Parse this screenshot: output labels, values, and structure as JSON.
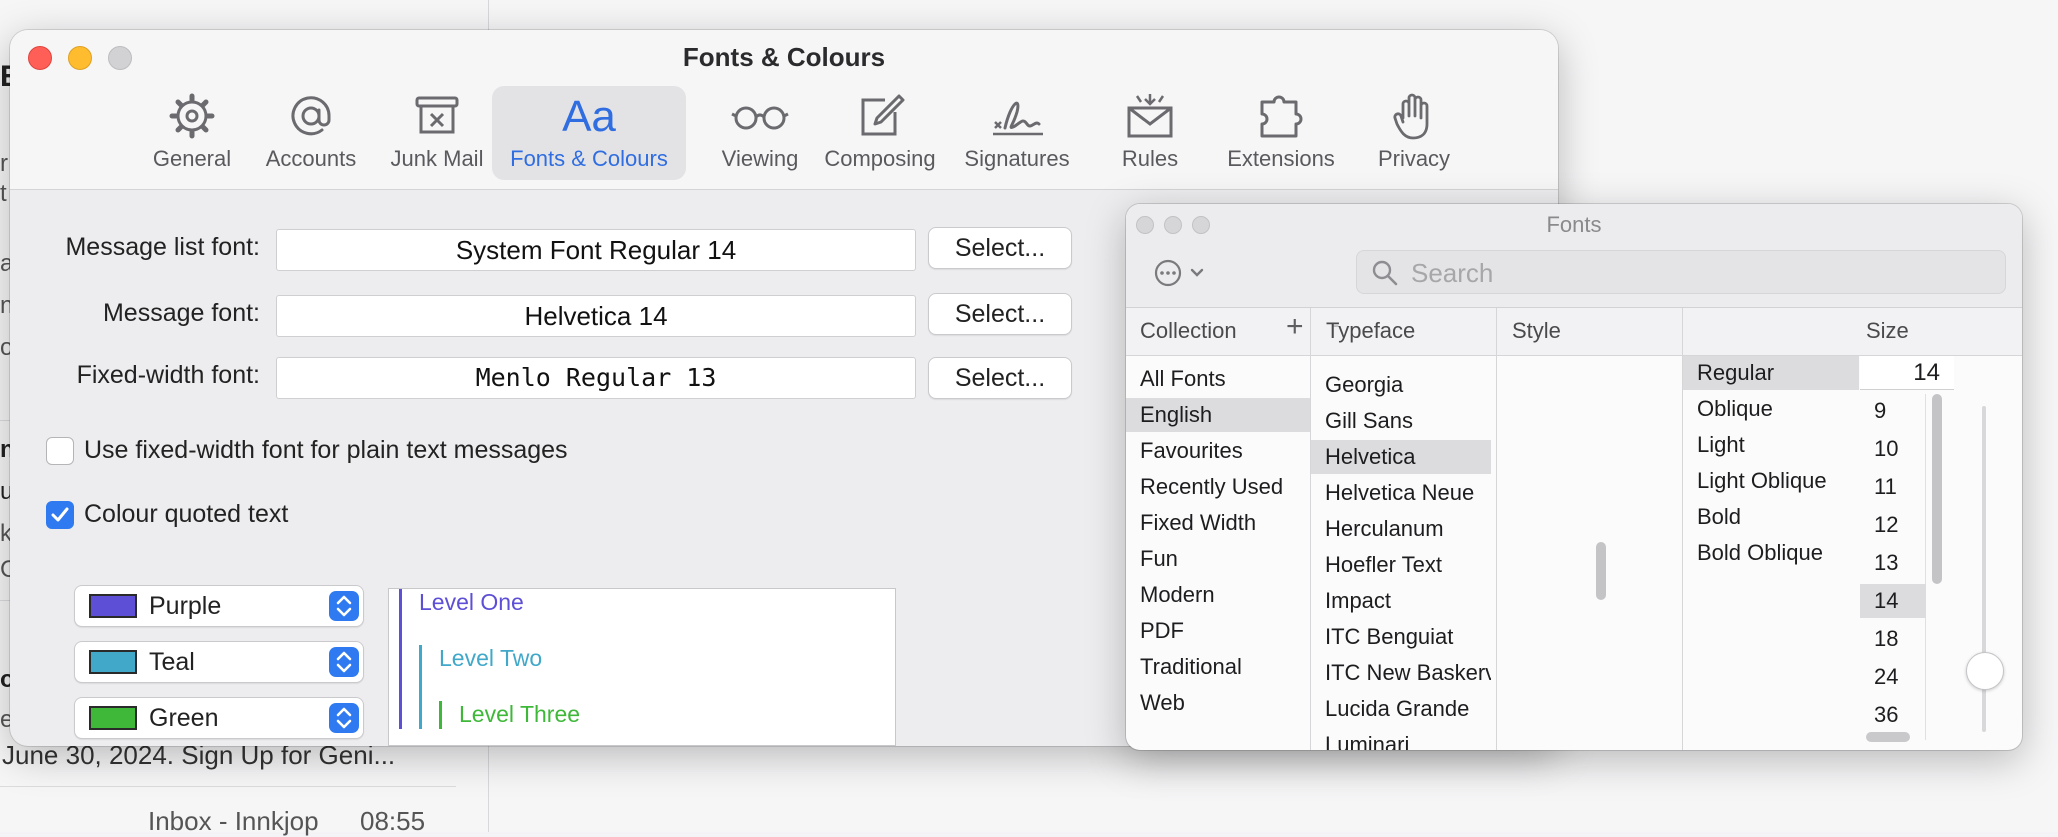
{
  "background": {
    "fragments": [
      "Er",
      "r",
      "t",
      "ab",
      "ne",
      "oc",
      "na",
      "ul",
      "ka",
      "C",
      "oc",
      "ex"
    ],
    "preview_text": "June 30, 2024. Sign Up for Geni...",
    "inbox_label": "Inbox - Innkjop",
    "inbox_time": "08:55"
  },
  "prefs": {
    "title": "Fonts & Colours",
    "tabs": [
      {
        "label": "General",
        "icon": "gear-icon"
      },
      {
        "label": "Accounts",
        "icon": "at-icon"
      },
      {
        "label": "Junk Mail",
        "icon": "junk-mail-icon"
      },
      {
        "label": "Fonts & Colours",
        "icon": "fonts-aa-icon",
        "glyph": "Aa",
        "active": true
      },
      {
        "label": "Viewing",
        "icon": "glasses-icon"
      },
      {
        "label": "Composing",
        "icon": "compose-icon"
      },
      {
        "label": "Signatures",
        "icon": "signature-icon"
      },
      {
        "label": "Rules",
        "icon": "rules-envelope-icon"
      },
      {
        "label": "Extensions",
        "icon": "puzzle-icon"
      },
      {
        "label": "Privacy",
        "icon": "hand-icon"
      }
    ],
    "fonts": [
      {
        "label": "Message list font:",
        "value": "System Font Regular 14",
        "button": "Select..."
      },
      {
        "label": "Message font:",
        "value": "Helvetica 14",
        "button": "Select..."
      },
      {
        "label": "Fixed-width font:",
        "value": "Menlo Regular 13",
        "button": "Select..."
      }
    ],
    "fixed_width_checkbox": {
      "label": "Use fixed-width font for plain text messages",
      "checked": false
    },
    "colour_quoted_checkbox": {
      "label": "Colour quoted text",
      "checked": true
    },
    "quote_colours": [
      {
        "name": "Purple",
        "color": "#5d4fd6"
      },
      {
        "name": "Teal",
        "color": "#41a8c9"
      },
      {
        "name": "Green",
        "color": "#3fb83a"
      }
    ],
    "preview_levels": [
      "Level One",
      "Level Two",
      "Level Three"
    ]
  },
  "fonts_panel": {
    "title": "Fonts",
    "search_placeholder": "Search",
    "headers": {
      "collection": "Collection",
      "plus": "+",
      "minus": "-",
      "typeface": "Typeface",
      "style": "Style",
      "size": "Size"
    },
    "collections": [
      "All Fonts",
      "English",
      "Favourites",
      "Recently Used",
      "Fixed Width",
      "Fun",
      "Modern",
      "PDF",
      "Traditional",
      "Web"
    ],
    "selected_collection": "English",
    "typefaces": [
      "Georgia",
      "Gill Sans",
      "Helvetica",
      "Helvetica Neue",
      "Herculanum",
      "Hoefler Text",
      "Impact",
      "ITC Benguiat",
      "ITC New Baskervil",
      "Lucida Grande",
      "Luminari"
    ],
    "selected_typeface": "Helvetica",
    "styles": [
      "Regular",
      "Oblique",
      "Light",
      "Light Oblique",
      "Bold",
      "Bold Oblique"
    ],
    "selected_style": "Regular",
    "size_value": "14",
    "sizes": [
      "9",
      "10",
      "11",
      "12",
      "13",
      "14",
      "18",
      "24",
      "36"
    ],
    "selected_size": "14",
    "size_slider_fraction": 0.6
  }
}
